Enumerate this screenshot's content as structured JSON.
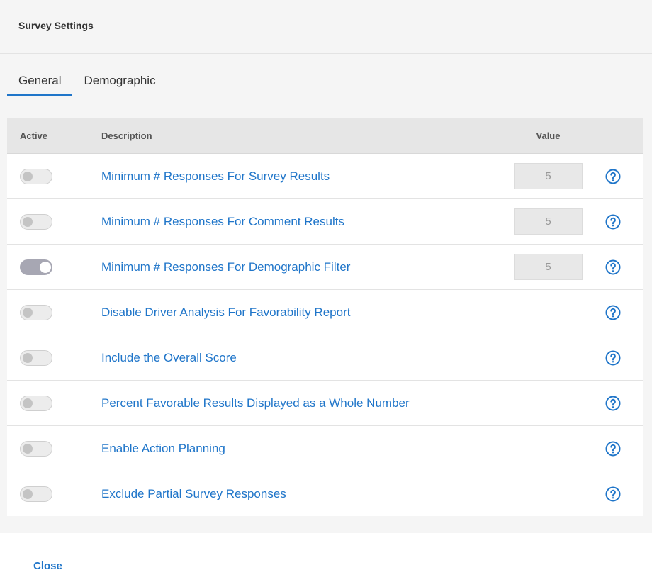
{
  "header": {
    "title": "Survey Settings"
  },
  "tabs": [
    {
      "label": "General",
      "active": true
    },
    {
      "label": "Demographic",
      "active": false
    }
  ],
  "table": {
    "columns": {
      "active": "Active",
      "description": "Description",
      "value": "Value"
    },
    "rows": [
      {
        "label": "Minimum # Responses For Survey Results",
        "active": false,
        "value": "5"
      },
      {
        "label": "Minimum # Responses For Comment Results",
        "active": false,
        "value": "5"
      },
      {
        "label": "Minimum # Responses For Demographic Filter",
        "active": true,
        "value": "5"
      },
      {
        "label": "Disable Driver Analysis For Favorability Report",
        "active": false,
        "value": null
      },
      {
        "label": "Include the Overall Score",
        "active": false,
        "value": null
      },
      {
        "label": "Percent Favorable Results Displayed as a Whole Number",
        "active": false,
        "value": null
      },
      {
        "label": "Enable Action Planning",
        "active": false,
        "value": null
      },
      {
        "label": "Exclude Partial Survey Responses",
        "active": false,
        "value": null
      }
    ]
  },
  "footer": {
    "close_label": "Close"
  },
  "colors": {
    "accent": "#1f75c9",
    "toggle_on": "#a7a7b3"
  },
  "icons": {
    "help": "question-circle-icon"
  }
}
